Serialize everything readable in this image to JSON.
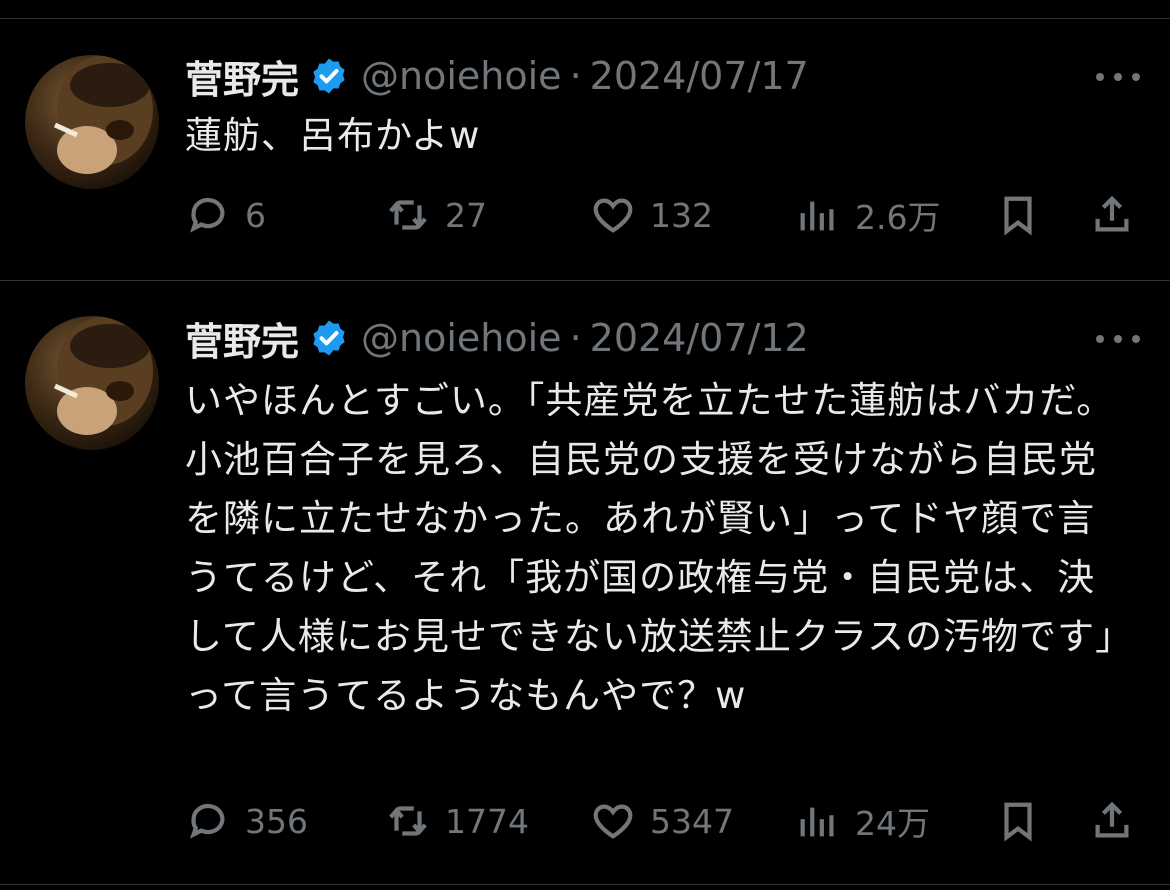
{
  "tweets": [
    {
      "author": {
        "name": "菅野完",
        "handle": "@noiehoie",
        "separator": "·",
        "date": "2024/07/17"
      },
      "text": "蓮舫、呂布かよw",
      "stats": {
        "replies": "6",
        "retweets": "27",
        "likes": "132",
        "views": "2.6万"
      }
    },
    {
      "author": {
        "name": "菅野完",
        "handle": "@noiehoie",
        "separator": "·",
        "date": "2024/07/12"
      },
      "text": "いやほんとすごい。「共産党を立たせた蓮舫はバカだ。小池百合子を見ろ、自民党の支援を受けながら自民党を隣に立たせなかった。あれが賢い」ってドヤ顔で言うてるけど、それ「我が国の政権与党・自民党は、決して人様にお見せできない放送禁止クラスの汚物です」って言うてるようなもんやで？w",
      "stats": {
        "replies": "356",
        "retweets": "1774",
        "likes": "5347",
        "views": "24万"
      }
    }
  ],
  "colors": {
    "background": "#000000",
    "text": "#e7e9ea",
    "muted": "#71767b",
    "verified": "#1d9bf0",
    "divider": "#2f3336"
  },
  "icons": {
    "verified": "verified-badge-icon",
    "more": "more-options-icon",
    "reply": "reply-icon",
    "retweet": "retweet-icon",
    "like": "heart-icon",
    "views": "views-chart-icon",
    "bookmark": "bookmark-icon",
    "share": "share-icon"
  }
}
